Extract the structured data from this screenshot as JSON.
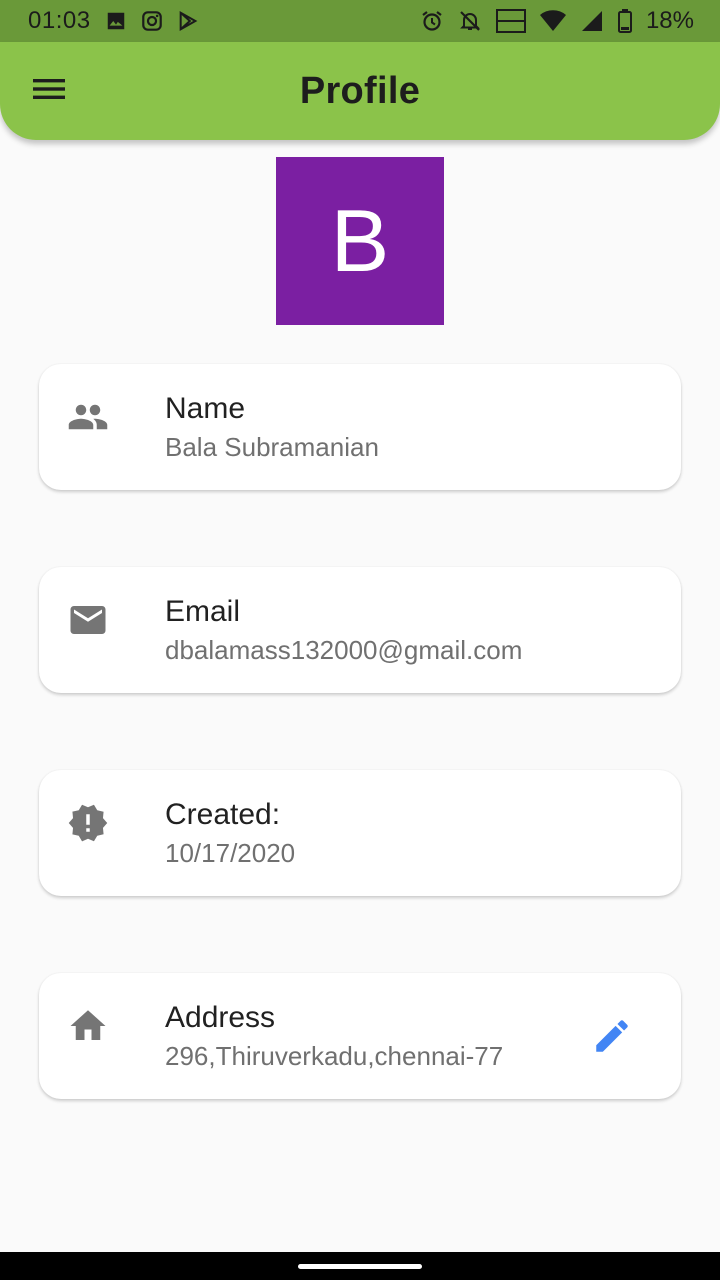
{
  "status_bar": {
    "time": "01:03",
    "battery_text": "18%",
    "network_badge": "VO LTE",
    "left_icons": [
      "image-icon",
      "instagram-icon",
      "play-store-icon"
    ],
    "right_icons": [
      "alarm-icon",
      "notifications-off-icon",
      "volte-icon",
      "wifi-icon",
      "signal-icon",
      "battery-icon"
    ]
  },
  "app_bar": {
    "title": "Profile",
    "menu_icon": "menu-icon",
    "color": "#8bc34a"
  },
  "avatar": {
    "initial": "B",
    "color": "#7b1fa2"
  },
  "cards": {
    "name": {
      "icon": "people-icon",
      "label": "Name",
      "value": "Bala Subramanian"
    },
    "email": {
      "icon": "mail-icon",
      "label": "Email",
      "value": "dbalamass132000@gmail.com"
    },
    "created": {
      "icon": "new-releases-icon",
      "label": "Created:",
      "value": "10/17/2020"
    },
    "address": {
      "icon": "home-icon",
      "label": "Address",
      "value": "296,Thiruverkadu,chennai-77",
      "action_icon": "edit-icon",
      "action_color": "#4285f4"
    }
  }
}
